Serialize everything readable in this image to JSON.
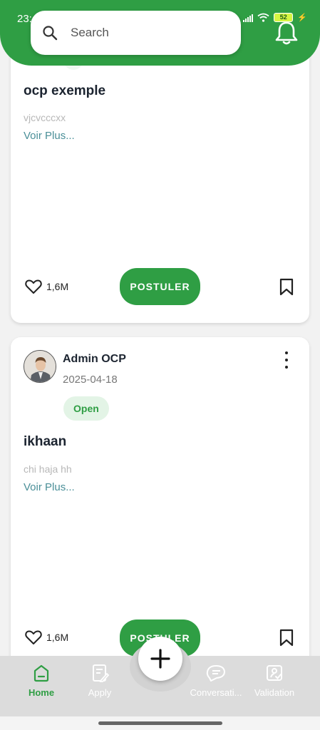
{
  "status_bar": {
    "time": "23:",
    "battery": "52"
  },
  "search": {
    "placeholder": "Search"
  },
  "posts": [
    {
      "title": "ocp exemple",
      "description": "vjcvcccxx",
      "see_more": "Voir Plus...",
      "likes": "1,6M",
      "apply_label": "POSTULER"
    },
    {
      "author": "Admin OCP",
      "date": "2025-04-18",
      "status": "Open",
      "title": "ikhaan",
      "description": "chi haja hh",
      "see_more": "Voir Plus...",
      "likes": "1,6M",
      "apply_label": "POSTULER"
    }
  ],
  "bottom_nav": {
    "items": [
      {
        "label": "Home",
        "icon": "home-icon",
        "active": true
      },
      {
        "label": "Apply",
        "icon": "apply-icon",
        "active": false
      },
      {
        "label": "Conversati...",
        "icon": "chat-icon",
        "active": false
      },
      {
        "label": "Validation",
        "icon": "validation-icon",
        "active": false
      }
    ],
    "fab_icon": "plus-icon"
  },
  "colors": {
    "brand_green": "#2f9e44",
    "badge_bg": "#e3f4e6",
    "link": "#4a8f98"
  }
}
